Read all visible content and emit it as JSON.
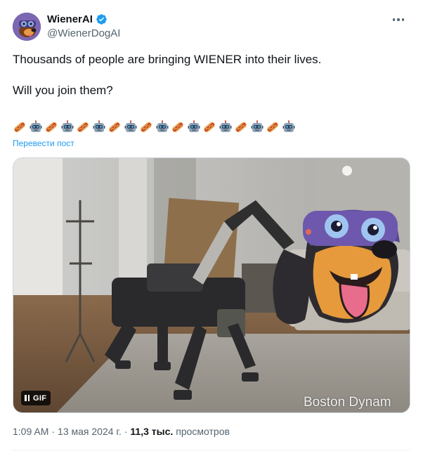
{
  "author": {
    "display_name": "WienerAI",
    "handle": "@WienerDogAI",
    "verified": true,
    "verified_color": "#1d9bf0"
  },
  "tweet": {
    "line1": "Thousands of people are bringing WIENER into their lives.",
    "line2": "Will you join them?",
    "emoji_sequence": [
      "hotdog",
      "robot",
      "hotdog",
      "robot",
      "hotdog",
      "robot",
      "hotdog",
      "robot",
      "hotdog",
      "robot",
      "hotdog",
      "robot",
      "hotdog",
      "robot",
      "hotdog",
      "robot",
      "hotdog",
      "robot"
    ],
    "translate_label": "Перевести пост"
  },
  "media": {
    "type": "gif",
    "gif_badge": "GIF",
    "watermark": "Boston Dynam"
  },
  "meta": {
    "time": "1:09 AM",
    "separator": "·",
    "date": "13 мая 2024 г.",
    "separator2": "·",
    "views_count": "11,3 тыс.",
    "views_label": "просмотров"
  },
  "colors": {
    "text": "#0f1419",
    "secondary": "#536471",
    "link": "#1d9bf0",
    "border": "#cfd9de"
  }
}
